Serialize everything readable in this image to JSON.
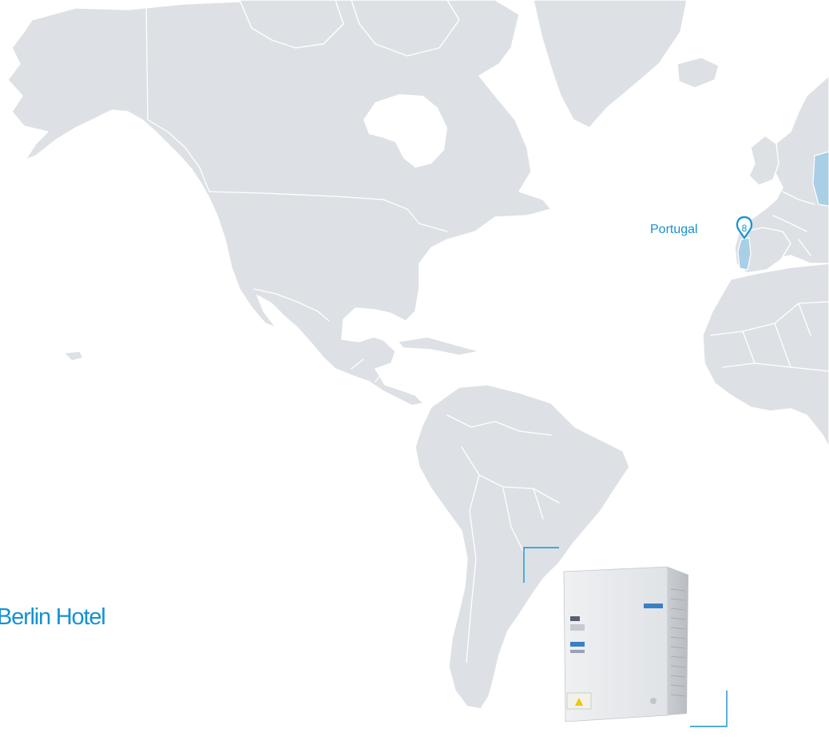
{
  "map": {
    "marker": {
      "country": "Portugal",
      "number": "8"
    },
    "project_title": "Berlin Hotel",
    "colors": {
      "land": "#dde1e5",
      "border": "#ffffff",
      "highlight": "#a9cfe6",
      "accent": "#1492d2"
    }
  },
  "product": {
    "name": "outdoor-ac-unit"
  }
}
